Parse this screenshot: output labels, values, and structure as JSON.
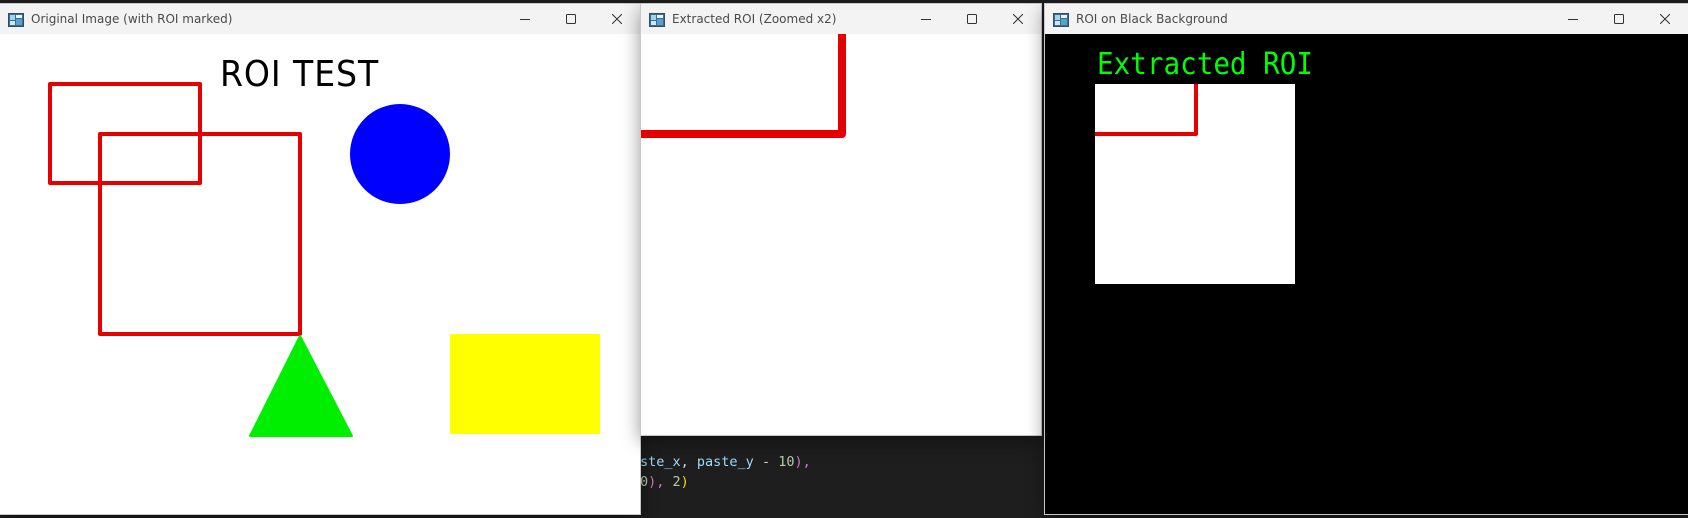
{
  "windows": {
    "original": {
      "title": "Original Image (with ROI marked)",
      "heading": "ROI TEST"
    },
    "extracted": {
      "title": "Extracted ROI (Zoomed x2)"
    },
    "black": {
      "title": "ROI on Black Background",
      "heading": "Extracted ROI"
    }
  },
  "code": {
    "line1": {
      "a": "ste_x",
      "b": ", ",
      "c": "paste_y",
      "d": " - ",
      "e": "10",
      "f": "),"
    },
    "line2": {
      "a": "0",
      "b": "), ",
      "c": "2",
      "d": ")"
    }
  },
  "colors": {
    "roi_outline": "#e60000",
    "circle": "#0000ff",
    "triangle": "#00ee00",
    "rectangle": "#ffff00",
    "green_text": "#00ff00"
  },
  "icons": {
    "app": "opencv-window-icon",
    "minimize": "minimize-icon",
    "maximize": "maximize-icon",
    "close": "close-icon"
  }
}
